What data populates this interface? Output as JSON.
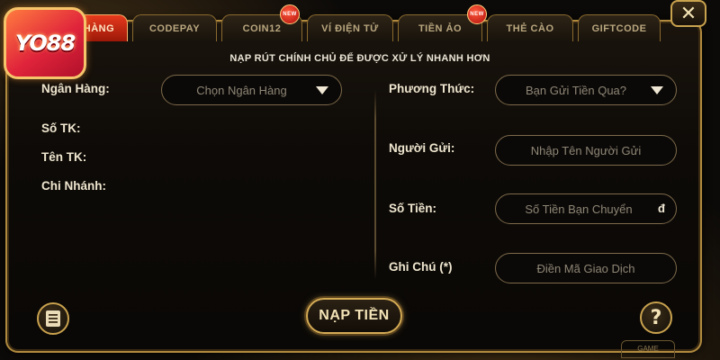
{
  "tabs": [
    {
      "label": "HÀNG",
      "active": true,
      "new": false
    },
    {
      "label": "CODEPAY",
      "active": false,
      "new": false
    },
    {
      "label": "COIN12",
      "active": false,
      "new": true
    },
    {
      "label": "VÍ ĐIỆN TỬ",
      "active": false,
      "new": false
    },
    {
      "label": "TIỀN ẢO",
      "active": false,
      "new": true
    },
    {
      "label": "THẺ CÀO",
      "active": false,
      "new": false
    },
    {
      "label": "GIFTCODE",
      "active": false,
      "new": false
    }
  ],
  "new_badge": "NEW",
  "logo": {
    "text": "YO88"
  },
  "close_label": "✕",
  "notice": "NẠP RÚT CHÍNH CHỦ ĐỂ ĐƯỢC XỬ LÝ NHANH HƠN",
  "left": {
    "bank_label": "Ngân Hàng:",
    "bank_select": "Chọn Ngân Hàng",
    "account_number_label": "Số TK:",
    "account_name_label": "Tên TK:",
    "branch_label": "Chi Nhánh:"
  },
  "right": {
    "method_label": "Phương Thức:",
    "method_select": "Bạn Gửi Tiền Qua?",
    "sender_label": "Người Gửi:",
    "sender_placeholder": "Nhập Tên Người Gửi",
    "amount_label": "Số Tiền:",
    "amount_placeholder": "Số Tiền Bạn Chuyển",
    "currency_symbol": "đ",
    "note_label": "Ghi Chú (*)",
    "note_placeholder": "Điền Mã Giao Dịch"
  },
  "deposit_button": "NẠP TIỀN",
  "help_glyph": "?",
  "bottom_deco": "GAME",
  "colors": {
    "gold_border": "#c9a24e",
    "active_tab": "#e63a1d",
    "text": "#efe6cf"
  }
}
